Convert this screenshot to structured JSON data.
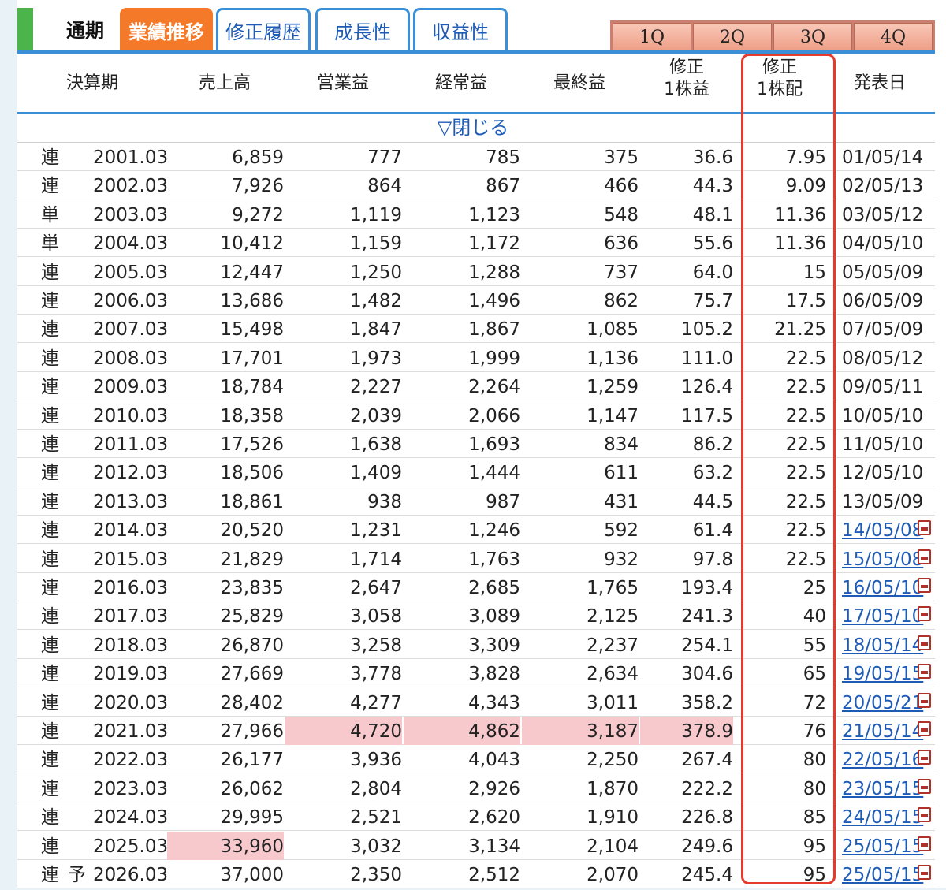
{
  "tabs": {
    "base_label": "通期",
    "items": [
      {
        "label": "業績推移",
        "active": true
      },
      {
        "label": "修正履歴",
        "active": false
      },
      {
        "label": "成長性",
        "active": false
      },
      {
        "label": "収益性",
        "active": false
      }
    ],
    "quarters": [
      "1Q",
      "2Q",
      "3Q",
      "4Q"
    ]
  },
  "columns": {
    "period": "決算期",
    "sales": "売上高",
    "operating": "営業益",
    "ordinary": "経常益",
    "net": "最終益",
    "eps_line1": "修正",
    "eps_line2": "1株益",
    "div_line1": "修正",
    "div_line2": "1株配",
    "date": "発表日"
  },
  "toggle_label": "▽閉じる",
  "colors": {
    "accent_tab": "#f47a2a",
    "link": "#1d5bb6",
    "highlight": "#f7c8cc",
    "frame": "#e53b2e",
    "green": "#4bb44b"
  },
  "rows": [
    {
      "type": "連",
      "forecast": "",
      "period": "2001.03",
      "sales": "6,859",
      "op": "777",
      "ord": "785",
      "net": "375",
      "eps": "36.6",
      "div": "7.95",
      "date": "01/05/14",
      "link": false
    },
    {
      "type": "連",
      "forecast": "",
      "period": "2002.03",
      "sales": "7,926",
      "op": "864",
      "ord": "867",
      "net": "466",
      "eps": "44.3",
      "div": "9.09",
      "date": "02/05/13",
      "link": false
    },
    {
      "type": "単",
      "forecast": "",
      "period": "2003.03",
      "sales": "9,272",
      "op": "1,119",
      "ord": "1,123",
      "net": "548",
      "eps": "48.1",
      "div": "11.36",
      "date": "03/05/12",
      "link": false
    },
    {
      "type": "単",
      "forecast": "",
      "period": "2004.03",
      "sales": "10,412",
      "op": "1,159",
      "ord": "1,172",
      "net": "636",
      "eps": "55.6",
      "div": "11.36",
      "date": "04/05/10",
      "link": false
    },
    {
      "type": "連",
      "forecast": "",
      "period": "2005.03",
      "sales": "12,447",
      "op": "1,250",
      "ord": "1,288",
      "net": "737",
      "eps": "64.0",
      "div": "15",
      "date": "05/05/09",
      "link": false
    },
    {
      "type": "連",
      "forecast": "",
      "period": "2006.03",
      "sales": "13,686",
      "op": "1,482",
      "ord": "1,496",
      "net": "862",
      "eps": "75.7",
      "div": "17.5",
      "date": "06/05/09",
      "link": false
    },
    {
      "type": "連",
      "forecast": "",
      "period": "2007.03",
      "sales": "15,498",
      "op": "1,847",
      "ord": "1,867",
      "net": "1,085",
      "eps": "105.2",
      "div": "21.25",
      "date": "07/05/09",
      "link": false
    },
    {
      "type": "連",
      "forecast": "",
      "period": "2008.03",
      "sales": "17,701",
      "op": "1,973",
      "ord": "1,999",
      "net": "1,136",
      "eps": "111.0",
      "div": "22.5",
      "date": "08/05/12",
      "link": false
    },
    {
      "type": "連",
      "forecast": "",
      "period": "2009.03",
      "sales": "18,784",
      "op": "2,227",
      "ord": "2,264",
      "net": "1,259",
      "eps": "126.4",
      "div": "22.5",
      "date": "09/05/11",
      "link": false
    },
    {
      "type": "連",
      "forecast": "",
      "period": "2010.03",
      "sales": "18,358",
      "op": "2,039",
      "ord": "2,066",
      "net": "1,147",
      "eps": "117.5",
      "div": "22.5",
      "date": "10/05/10",
      "link": false
    },
    {
      "type": "連",
      "forecast": "",
      "period": "2011.03",
      "sales": "17,526",
      "op": "1,638",
      "ord": "1,693",
      "net": "834",
      "eps": "86.2",
      "div": "22.5",
      "date": "11/05/10",
      "link": false
    },
    {
      "type": "連",
      "forecast": "",
      "period": "2012.03",
      "sales": "18,506",
      "op": "1,409",
      "ord": "1,444",
      "net": "611",
      "eps": "63.2",
      "div": "22.5",
      "date": "12/05/10",
      "link": false
    },
    {
      "type": "連",
      "forecast": "",
      "period": "2013.03",
      "sales": "18,861",
      "op": "938",
      "ord": "987",
      "net": "431",
      "eps": "44.5",
      "div": "22.5",
      "date": "13/05/09",
      "link": false
    },
    {
      "type": "連",
      "forecast": "",
      "period": "2014.03",
      "sales": "20,520",
      "op": "1,231",
      "ord": "1,246",
      "net": "592",
      "eps": "61.4",
      "div": "22.5",
      "date": "14/05/08",
      "link": true
    },
    {
      "type": "連",
      "forecast": "",
      "period": "2015.03",
      "sales": "21,829",
      "op": "1,714",
      "ord": "1,763",
      "net": "932",
      "eps": "97.8",
      "div": "22.5",
      "date": "15/05/08",
      "link": true
    },
    {
      "type": "連",
      "forecast": "",
      "period": "2016.03",
      "sales": "23,835",
      "op": "2,647",
      "ord": "2,685",
      "net": "1,765",
      "eps": "193.4",
      "div": "25",
      "date": "16/05/10",
      "link": true
    },
    {
      "type": "連",
      "forecast": "",
      "period": "2017.03",
      "sales": "25,829",
      "op": "3,058",
      "ord": "3,089",
      "net": "2,125",
      "eps": "241.3",
      "div": "40",
      "date": "17/05/10",
      "link": true
    },
    {
      "type": "連",
      "forecast": "",
      "period": "2018.03",
      "sales": "26,870",
      "op": "3,258",
      "ord": "3,309",
      "net": "2,237",
      "eps": "254.1",
      "div": "55",
      "date": "18/05/14",
      "link": true
    },
    {
      "type": "連",
      "forecast": "",
      "period": "2019.03",
      "sales": "27,669",
      "op": "3,778",
      "ord": "3,828",
      "net": "2,634",
      "eps": "304.6",
      "div": "65",
      "date": "19/05/15",
      "link": true
    },
    {
      "type": "連",
      "forecast": "",
      "period": "2020.03",
      "sales": "28,402",
      "op": "4,277",
      "ord": "4,343",
      "net": "3,011",
      "eps": "358.2",
      "div": "72",
      "date": "20/05/21",
      "link": true
    },
    {
      "type": "連",
      "forecast": "",
      "period": "2021.03",
      "sales": "27,966",
      "op": "4,720",
      "ord": "4,862",
      "net": "3,187",
      "eps": "378.9",
      "div": "76",
      "date": "21/05/14",
      "link": true,
      "hl": [
        "op",
        "ord",
        "net",
        "eps"
      ]
    },
    {
      "type": "連",
      "forecast": "",
      "period": "2022.03",
      "sales": "26,177",
      "op": "3,936",
      "ord": "4,043",
      "net": "2,250",
      "eps": "267.4",
      "div": "80",
      "date": "22/05/16",
      "link": true
    },
    {
      "type": "連",
      "forecast": "",
      "period": "2023.03",
      "sales": "26,062",
      "op": "2,804",
      "ord": "2,926",
      "net": "1,870",
      "eps": "222.2",
      "div": "80",
      "date": "23/05/15",
      "link": true
    },
    {
      "type": "連",
      "forecast": "",
      "period": "2024.03",
      "sales": "29,995",
      "op": "2,521",
      "ord": "2,620",
      "net": "1,910",
      "eps": "226.8",
      "div": "85",
      "date": "24/05/15",
      "link": true
    },
    {
      "type": "連",
      "forecast": "",
      "period": "2025.03",
      "sales": "33,960",
      "op": "3,032",
      "ord": "3,134",
      "net": "2,104",
      "eps": "249.6",
      "div": "95",
      "date": "25/05/15",
      "link": true,
      "hl": [
        "sales"
      ]
    },
    {
      "type": "連",
      "forecast": "予",
      "period": "2026.03",
      "sales": "37,000",
      "op": "2,350",
      "ord": "2,512",
      "net": "2,070",
      "eps": "245.4",
      "div": "95",
      "date": "25/05/15",
      "link": true
    }
  ]
}
